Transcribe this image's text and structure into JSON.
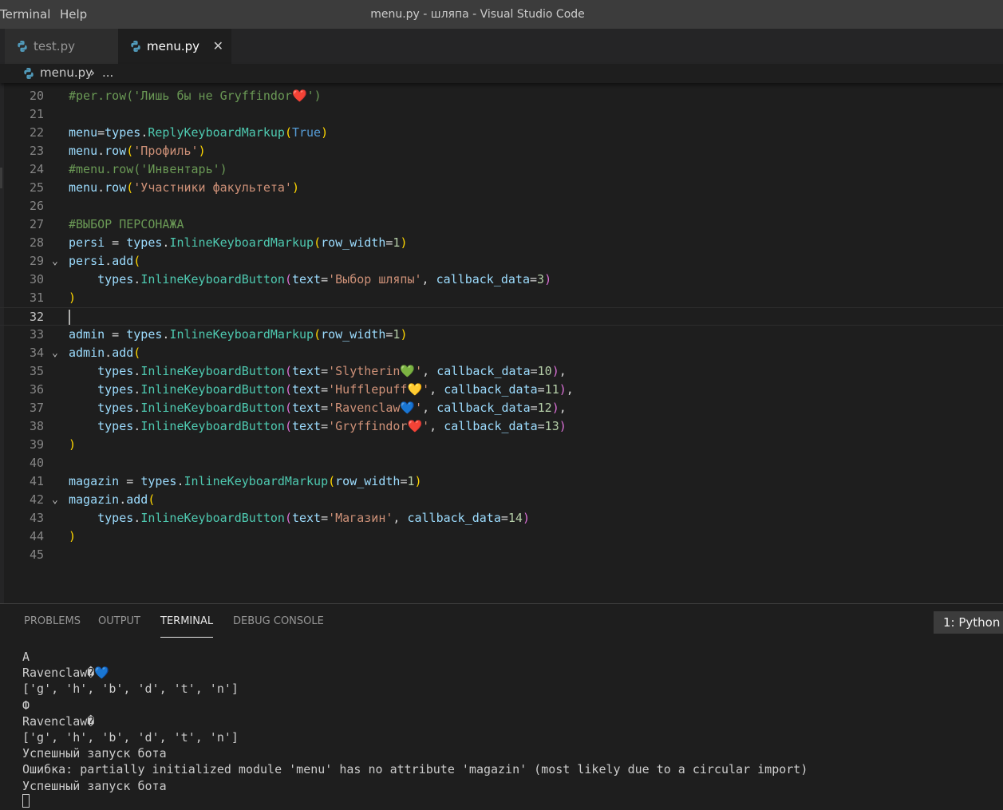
{
  "titlebar": {
    "menu": [
      "Terminal",
      "Help"
    ],
    "title": "menu.py - шляпа - Visual Studio Code"
  },
  "tabs": [
    {
      "label": "test.py",
      "icon": "python-file-icon",
      "active": false
    },
    {
      "label": "menu.py",
      "icon": "python-file-icon",
      "active": true,
      "close": "✕"
    }
  ],
  "breadcrumb": {
    "file": "menu.py",
    "separator": "›",
    "more": "..."
  },
  "editor": {
    "current_line": "32",
    "lines": [
      {
        "n": "20",
        "parts": [
          [
            "cmt",
            "#per.row('Лишь бы не Gryffindor❤️')"
          ]
        ]
      },
      {
        "n": "21",
        "parts": []
      },
      {
        "n": "22",
        "parts": [
          [
            "var",
            "menu"
          ],
          [
            "op",
            "="
          ],
          [
            "var",
            "types"
          ],
          [
            "op",
            "."
          ],
          [
            "cls",
            "ReplyKeyboardMarkup"
          ],
          [
            "b1",
            "("
          ],
          [
            "kw",
            "True"
          ],
          [
            "b1",
            ")"
          ]
        ]
      },
      {
        "n": "23",
        "parts": [
          [
            "var",
            "menu"
          ],
          [
            "op",
            "."
          ],
          [
            "var",
            "row"
          ],
          [
            "b1",
            "("
          ],
          [
            "str",
            "'Профиль'"
          ],
          [
            "b1",
            ")"
          ]
        ]
      },
      {
        "n": "24",
        "parts": [
          [
            "cmt",
            "#menu.row('Инвентарь')"
          ]
        ]
      },
      {
        "n": "25",
        "parts": [
          [
            "var",
            "menu"
          ],
          [
            "op",
            "."
          ],
          [
            "var",
            "row"
          ],
          [
            "b1",
            "("
          ],
          [
            "str",
            "'Участники факультета'"
          ],
          [
            "b1",
            ")"
          ]
        ]
      },
      {
        "n": "26",
        "parts": []
      },
      {
        "n": "27",
        "parts": [
          [
            "cmt",
            "#ВЫБОР ПЕРСОНАЖА"
          ]
        ]
      },
      {
        "n": "28",
        "parts": [
          [
            "var",
            "persi"
          ],
          [
            "op",
            " = "
          ],
          [
            "var",
            "types"
          ],
          [
            "op",
            "."
          ],
          [
            "cls",
            "InlineKeyboardMarkup"
          ],
          [
            "b1",
            "("
          ],
          [
            "var",
            "row_width"
          ],
          [
            "op",
            "="
          ],
          [
            "num",
            "1"
          ],
          [
            "b1",
            ")"
          ]
        ]
      },
      {
        "n": "29",
        "fold": "⌄",
        "parts": [
          [
            "var",
            "persi"
          ],
          [
            "op",
            "."
          ],
          [
            "var",
            "add"
          ],
          [
            "b1",
            "("
          ]
        ]
      },
      {
        "n": "30",
        "parts": [
          [
            "op",
            "    "
          ],
          [
            "var",
            "types"
          ],
          [
            "op",
            "."
          ],
          [
            "cls",
            "InlineKeyboardButton"
          ],
          [
            "b2",
            "("
          ],
          [
            "var",
            "text"
          ],
          [
            "op",
            "="
          ],
          [
            "str",
            "'Выбор шляпы'"
          ],
          [
            "op",
            ", "
          ],
          [
            "var",
            "callback_data"
          ],
          [
            "op",
            "="
          ],
          [
            "num",
            "3"
          ],
          [
            "b2",
            ")"
          ]
        ]
      },
      {
        "n": "31",
        "parts": [
          [
            "b1",
            ")"
          ]
        ]
      },
      {
        "n": "32",
        "parts": []
      },
      {
        "n": "33",
        "parts": [
          [
            "var",
            "admin"
          ],
          [
            "op",
            " = "
          ],
          [
            "var",
            "types"
          ],
          [
            "op",
            "."
          ],
          [
            "cls",
            "InlineKeyboardMarkup"
          ],
          [
            "b1",
            "("
          ],
          [
            "var",
            "row_width"
          ],
          [
            "op",
            "="
          ],
          [
            "num",
            "1"
          ],
          [
            "b1",
            ")"
          ]
        ]
      },
      {
        "n": "34",
        "fold": "⌄",
        "parts": [
          [
            "var",
            "admin"
          ],
          [
            "op",
            "."
          ],
          [
            "var",
            "add"
          ],
          [
            "b1",
            "("
          ]
        ]
      },
      {
        "n": "35",
        "parts": [
          [
            "op",
            "    "
          ],
          [
            "var",
            "types"
          ],
          [
            "op",
            "."
          ],
          [
            "cls",
            "InlineKeyboardButton"
          ],
          [
            "b2",
            "("
          ],
          [
            "var",
            "text"
          ],
          [
            "op",
            "="
          ],
          [
            "str",
            "'Slytherin💚'"
          ],
          [
            "op",
            ", "
          ],
          [
            "var",
            "callback_data"
          ],
          [
            "op",
            "="
          ],
          [
            "num",
            "10"
          ],
          [
            "b2",
            ")"
          ],
          [
            "op",
            ","
          ]
        ]
      },
      {
        "n": "36",
        "parts": [
          [
            "op",
            "    "
          ],
          [
            "var",
            "types"
          ],
          [
            "op",
            "."
          ],
          [
            "cls",
            "InlineKeyboardButton"
          ],
          [
            "b2",
            "("
          ],
          [
            "var",
            "text"
          ],
          [
            "op",
            "="
          ],
          [
            "str",
            "'Hufflepuff💛'"
          ],
          [
            "op",
            ", "
          ],
          [
            "var",
            "callback_data"
          ],
          [
            "op",
            "="
          ],
          [
            "num",
            "11"
          ],
          [
            "b2",
            ")"
          ],
          [
            "op",
            ","
          ]
        ]
      },
      {
        "n": "37",
        "parts": [
          [
            "op",
            "    "
          ],
          [
            "var",
            "types"
          ],
          [
            "op",
            "."
          ],
          [
            "cls",
            "InlineKeyboardButton"
          ],
          [
            "b2",
            "("
          ],
          [
            "var",
            "text"
          ],
          [
            "op",
            "="
          ],
          [
            "str",
            "'Ravenclaw💙'"
          ],
          [
            "op",
            ", "
          ],
          [
            "var",
            "callback_data"
          ],
          [
            "op",
            "="
          ],
          [
            "num",
            "12"
          ],
          [
            "b2",
            ")"
          ],
          [
            "op",
            ","
          ]
        ]
      },
      {
        "n": "38",
        "parts": [
          [
            "op",
            "    "
          ],
          [
            "var",
            "types"
          ],
          [
            "op",
            "."
          ],
          [
            "cls",
            "InlineKeyboardButton"
          ],
          [
            "b2",
            "("
          ],
          [
            "var",
            "text"
          ],
          [
            "op",
            "="
          ],
          [
            "str",
            "'Gryffindor❤️'"
          ],
          [
            "op",
            ", "
          ],
          [
            "var",
            "callback_data"
          ],
          [
            "op",
            "="
          ],
          [
            "num",
            "13"
          ],
          [
            "b2",
            ")"
          ]
        ]
      },
      {
        "n": "39",
        "parts": [
          [
            "b1",
            ")"
          ]
        ]
      },
      {
        "n": "40",
        "parts": []
      },
      {
        "n": "41",
        "parts": [
          [
            "var",
            "magazin"
          ],
          [
            "op",
            " = "
          ],
          [
            "var",
            "types"
          ],
          [
            "op",
            "."
          ],
          [
            "cls",
            "InlineKeyboardMarkup"
          ],
          [
            "b1",
            "("
          ],
          [
            "var",
            "row_width"
          ],
          [
            "op",
            "="
          ],
          [
            "num",
            "1"
          ],
          [
            "b1",
            ")"
          ]
        ]
      },
      {
        "n": "42",
        "fold": "⌄",
        "parts": [
          [
            "var",
            "magazin"
          ],
          [
            "op",
            "."
          ],
          [
            "var",
            "add"
          ],
          [
            "b1",
            "("
          ]
        ]
      },
      {
        "n": "43",
        "parts": [
          [
            "op",
            "    "
          ],
          [
            "var",
            "types"
          ],
          [
            "op",
            "."
          ],
          [
            "cls",
            "InlineKeyboardButton"
          ],
          [
            "b2",
            "("
          ],
          [
            "var",
            "text"
          ],
          [
            "op",
            "="
          ],
          [
            "str",
            "'Магазин'"
          ],
          [
            "op",
            ", "
          ],
          [
            "var",
            "callback_data"
          ],
          [
            "op",
            "="
          ],
          [
            "num",
            "14"
          ],
          [
            "b2",
            ")"
          ]
        ]
      },
      {
        "n": "44",
        "parts": [
          [
            "b1",
            ")"
          ]
        ]
      },
      {
        "n": "45",
        "parts": []
      }
    ]
  },
  "panel": {
    "tabs": [
      "PROBLEMS",
      "OUTPUT",
      "TERMINAL",
      "DEBUG CONSOLE"
    ],
    "active_tab": "TERMINAL",
    "terminal_select": "1: Python",
    "terminal_lines": [
      "A",
      "Ravenclaw�💙",
      "['g', 'h', 'b', 'd', 't', 'n']",
      "Ф",
      "Ravenclaw�",
      "['g', 'h', 'b', 'd', 't', 'n']",
      "Успешный запуск бота",
      "Ошибка: partially initialized module 'menu' has no attribute 'magazin' (most likely due to a circular import)",
      "Успешный запуск бота"
    ]
  }
}
